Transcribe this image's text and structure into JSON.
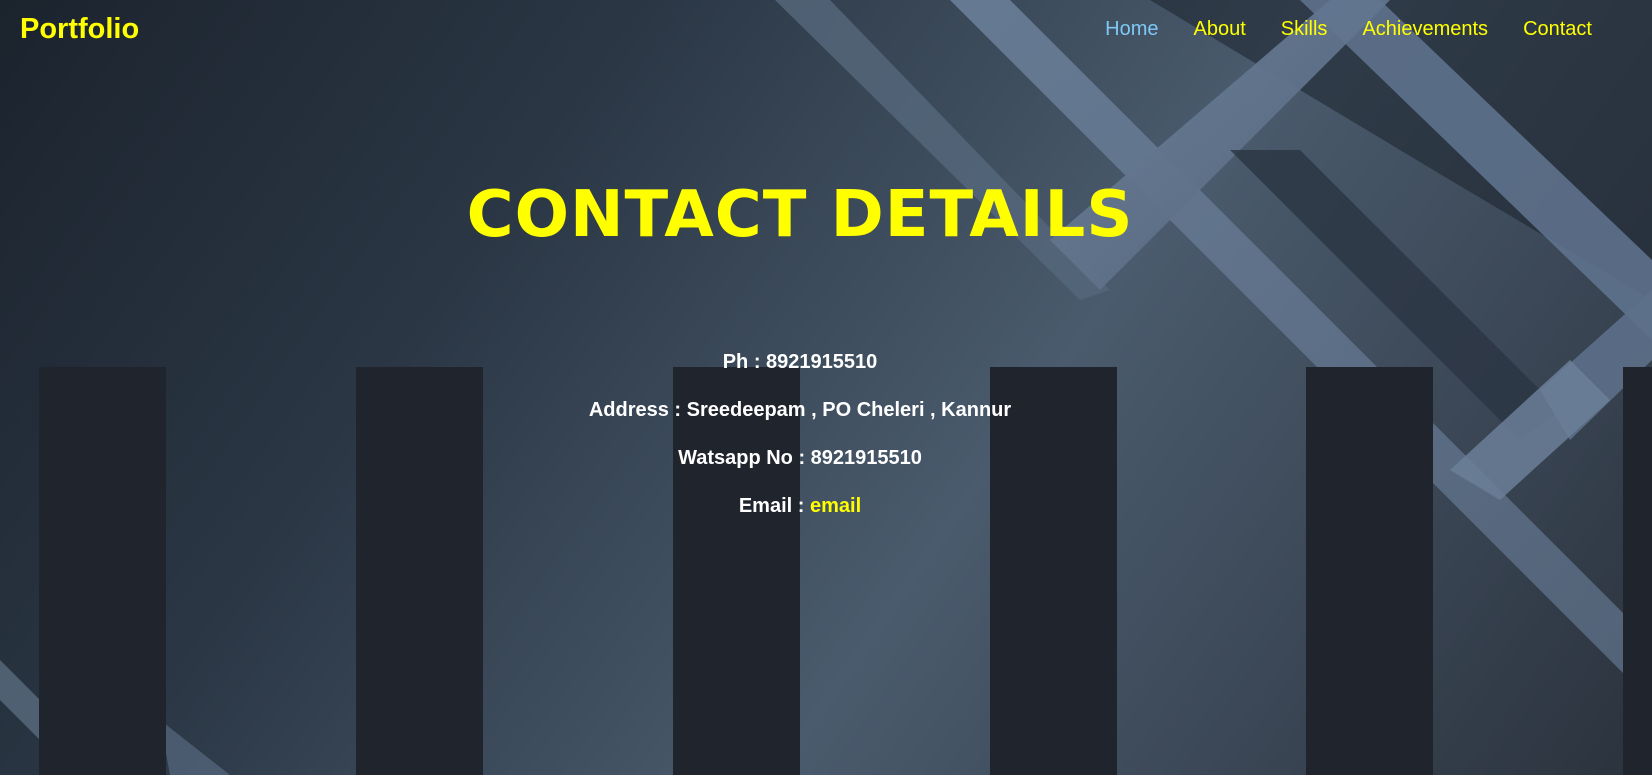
{
  "navbar": {
    "logo": "Portfolio",
    "links": [
      {
        "label": "Home",
        "active": true
      },
      {
        "label": "About"
      },
      {
        "label": "Skills"
      },
      {
        "label": "Achievements"
      },
      {
        "label": "Contact"
      }
    ]
  },
  "contact": {
    "heading": "CONTACT DETAILS",
    "phone": "Ph : 8921915510",
    "address": "Address : Sreedeepam , PO Cheleri , Kannur",
    "watsapp": "Watsapp No : 8921915510",
    "email_prefix": "Email : ",
    "email_link": "email"
  },
  "colors": {
    "accent": "#ffff00",
    "active_link": "#7ec8f5",
    "text": "#ffffff",
    "stripe": "#20242d"
  }
}
